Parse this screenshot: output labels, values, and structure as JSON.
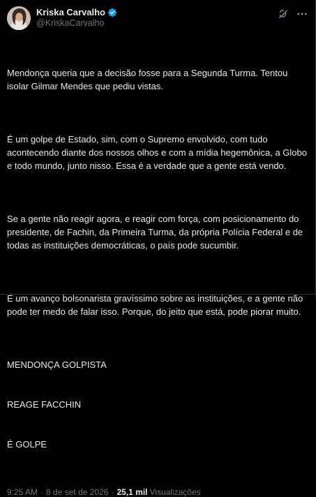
{
  "author": {
    "display_name": "Kriska Carvalho",
    "handle": "@KriskaCarvalho",
    "verified": true,
    "verified_color": "#1d9bf0"
  },
  "actions": {
    "grok_icon": "grok-icon",
    "more_icon": "more-options-icon"
  },
  "tweet": {
    "paragraph_1": "Mendonça queria que a decisão fosse para a Segunda Turma. Tentou isolar Gilmar Mendes que pediu vistas.",
    "paragraph_2": "É um golpe de Estado, sim, com o Supremo envolvido, com tudo acontecendo diante dos nossos olhos e com a mídia hegemônica, a Globo e todo mundo, junto nisso. Essa é a verdade que a gente está vendo.",
    "paragraph_3": "Se a gente não reagir agora, e reagir com força, com posicionamento do presidente, de Fachin, da Primeira Turma, da própria Polícia Federal e de todas as instituições democráticas, o país pode sucumbir.",
    "paragraph_4": "É um avanço bolsonarista gravíssimo sobre as instituições, e a gente não pode ter medo de falar isso. Porque, do jeito que está, pode piorar muito.",
    "caps_line_1": "MENDONÇA GOLPISTA",
    "caps_line_2": "REAGE FACCHIN",
    "caps_line_3": "É GOLPE"
  },
  "meta": {
    "time": "9:25 AM",
    "separator": "·",
    "date": "8 de set de 2026",
    "views_count": "25,1 mil",
    "views_label": "Visualizações"
  },
  "colors": {
    "background": "#000000",
    "text": "#e7e9ea",
    "secondary": "#71767b",
    "border": "#2f3336"
  }
}
